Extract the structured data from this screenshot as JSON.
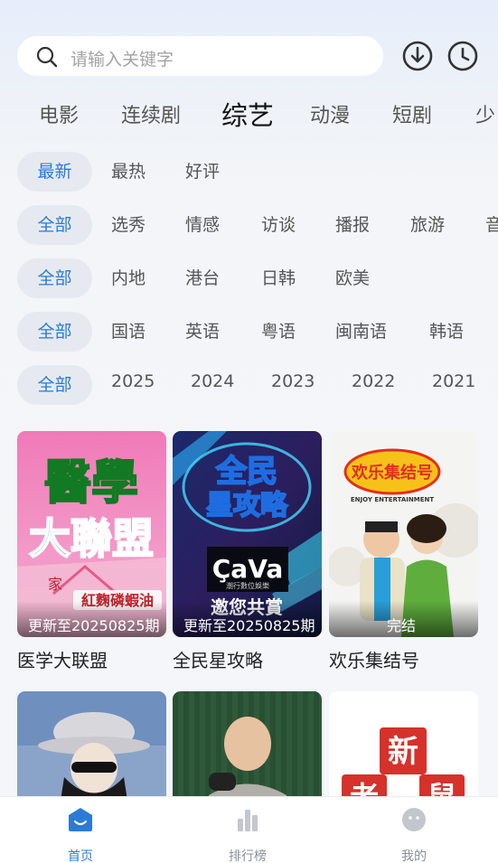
{
  "search": {
    "placeholder": "请输入关键字"
  },
  "header": {
    "icons": [
      "download-icon",
      "history-clock-icon"
    ]
  },
  "tabs": [
    {
      "label": "电影"
    },
    {
      "label": "连续剧"
    },
    {
      "label": "综艺",
      "active": true
    },
    {
      "label": "动漫"
    },
    {
      "label": "短剧"
    },
    {
      "label": "少"
    }
  ],
  "filters": {
    "sort": [
      "最新",
      "最热",
      "好评"
    ],
    "genre": [
      "全部",
      "选秀",
      "情感",
      "访谈",
      "播报",
      "旅游",
      "音"
    ],
    "region": [
      "全部",
      "内地",
      "港台",
      "日韩",
      "欧美"
    ],
    "language": [
      "全部",
      "国语",
      "英语",
      "粤语",
      "闽南语",
      "韩语"
    ],
    "year": [
      "全部",
      "2025",
      "2024",
      "2023",
      "2022",
      "2021"
    ]
  },
  "cards": [
    {
      "title": "医学大联盟",
      "status": "更新至20250825期",
      "poster_text": [
        "醫學",
        "大聯盟",
        "紅麴磷蝦油",
        "家"
      ]
    },
    {
      "title": "全民星攻略",
      "status": "更新至20250825期",
      "poster_text": [
        "全民",
        "星攻略",
        "ÇaVa",
        "潮行數位娛樂",
        "邀您共賞"
      ]
    },
    {
      "title": "欢乐集结号",
      "status": "完结",
      "poster_text": [
        "欢乐集结号",
        "ENJOY ENTERTAINMENT"
      ]
    },
    {
      "title": "",
      "status": ""
    },
    {
      "title": "",
      "status": ""
    },
    {
      "title": "",
      "status": "",
      "poster_text": [
        "新",
        "老",
        "鼠"
      ]
    }
  ],
  "bottom_nav": [
    {
      "label": "首页",
      "active": true,
      "icon": "home-icon"
    },
    {
      "label": "排行榜",
      "icon": "ranking-bars-icon"
    },
    {
      "label": "我的",
      "icon": "profile-face-icon"
    }
  ],
  "colors": {
    "accent": "#2a7bd6",
    "chip_bg": "#e6eaf0",
    "background": "#f4f6f9"
  }
}
